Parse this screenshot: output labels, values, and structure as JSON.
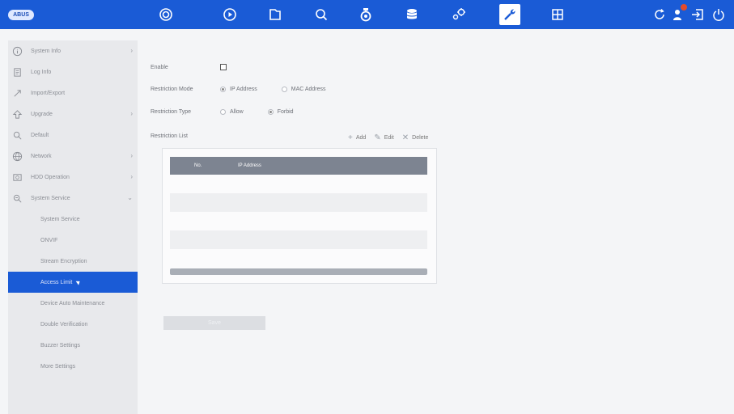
{
  "header": {
    "logo_text": "ABUS",
    "nav_icons": [
      "camera-icon",
      "playback-icon",
      "file-icon",
      "search-icon",
      "alarm-icon",
      "storage-icon",
      "config-icon",
      "maintenance-icon",
      "layout-icon"
    ],
    "active_icon": "maintenance-icon",
    "right_icons": [
      "refresh-icon",
      "user-alarm-icon",
      "logout-icon",
      "power-icon"
    ]
  },
  "sidebar": {
    "items": [
      {
        "label": "System Info",
        "icon": "info-icon",
        "expandable": true
      },
      {
        "label": "Log Info",
        "icon": "log-icon",
        "expandable": false
      },
      {
        "label": "Import/Export",
        "icon": "import-export-icon",
        "expandable": false
      },
      {
        "label": "Upgrade",
        "icon": "upgrade-icon",
        "expandable": true
      },
      {
        "label": "Default",
        "icon": "default-icon",
        "expandable": false
      },
      {
        "label": "Network",
        "icon": "network-icon",
        "expandable": true
      },
      {
        "label": "HDD Operation",
        "icon": "hdd-icon",
        "expandable": true
      },
      {
        "label": "System Service",
        "icon": "service-icon",
        "expandable": true
      }
    ],
    "sub_items": [
      {
        "label": "System Service"
      },
      {
        "label": "ONVIF"
      },
      {
        "label": "Stream Encryption"
      },
      {
        "label": "Access Limit"
      },
      {
        "label": "Device Auto Maintenance"
      },
      {
        "label": "Double Verification"
      },
      {
        "label": "Buzzer Settings"
      },
      {
        "label": "More Settings"
      }
    ],
    "active_sub": "Access Limit"
  },
  "form": {
    "enable_label": "Enable",
    "enable_checked": false,
    "mode_label": "Restriction Mode",
    "mode_options": [
      "IP Address",
      "MAC Address"
    ],
    "mode_selected": "IP Address",
    "type_label": "Restriction Type",
    "type_options": [
      "Allow",
      "Forbid"
    ],
    "type_selected": "Forbid",
    "list_label": "Restriction List"
  },
  "actions": {
    "add": "Add",
    "edit": "Edit",
    "delete": "Delete"
  },
  "table": {
    "columns": [
      "No.",
      "IP Address"
    ],
    "rows": []
  },
  "save_label": "Save",
  "colors": {
    "accent": "#1a5bd6",
    "header_row": "#7d8491"
  }
}
